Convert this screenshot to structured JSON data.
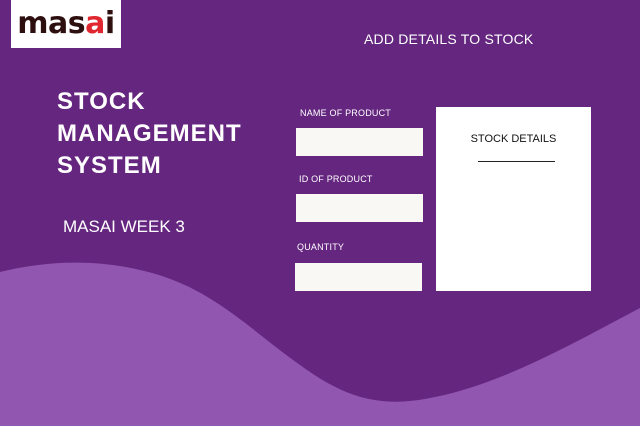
{
  "logo": {
    "prefix": "mas",
    "accent": "a",
    "suffix": "i"
  },
  "header": {
    "title": "ADD DETAILS TO STOCK"
  },
  "hero": {
    "title_lines": [
      "STOCK",
      "MANAGEMENT",
      "SYSTEM"
    ],
    "subtitle": "MASAI WEEK 3"
  },
  "form": {
    "name_label": "NAME OF PRODUCT",
    "name_value": "",
    "id_label": "ID OF PRODUCT",
    "id_value": "",
    "quantity_label": "QUANTITY",
    "quantity_value": ""
  },
  "panel": {
    "title": "STOCK DETAILS"
  },
  "colors": {
    "background": "#65267f",
    "wave": "#9157b0",
    "logo_text": "#2e0f0f",
    "logo_accent": "#e0262e",
    "input_bg": "#faf8f5",
    "panel_bg": "#ffffff"
  }
}
